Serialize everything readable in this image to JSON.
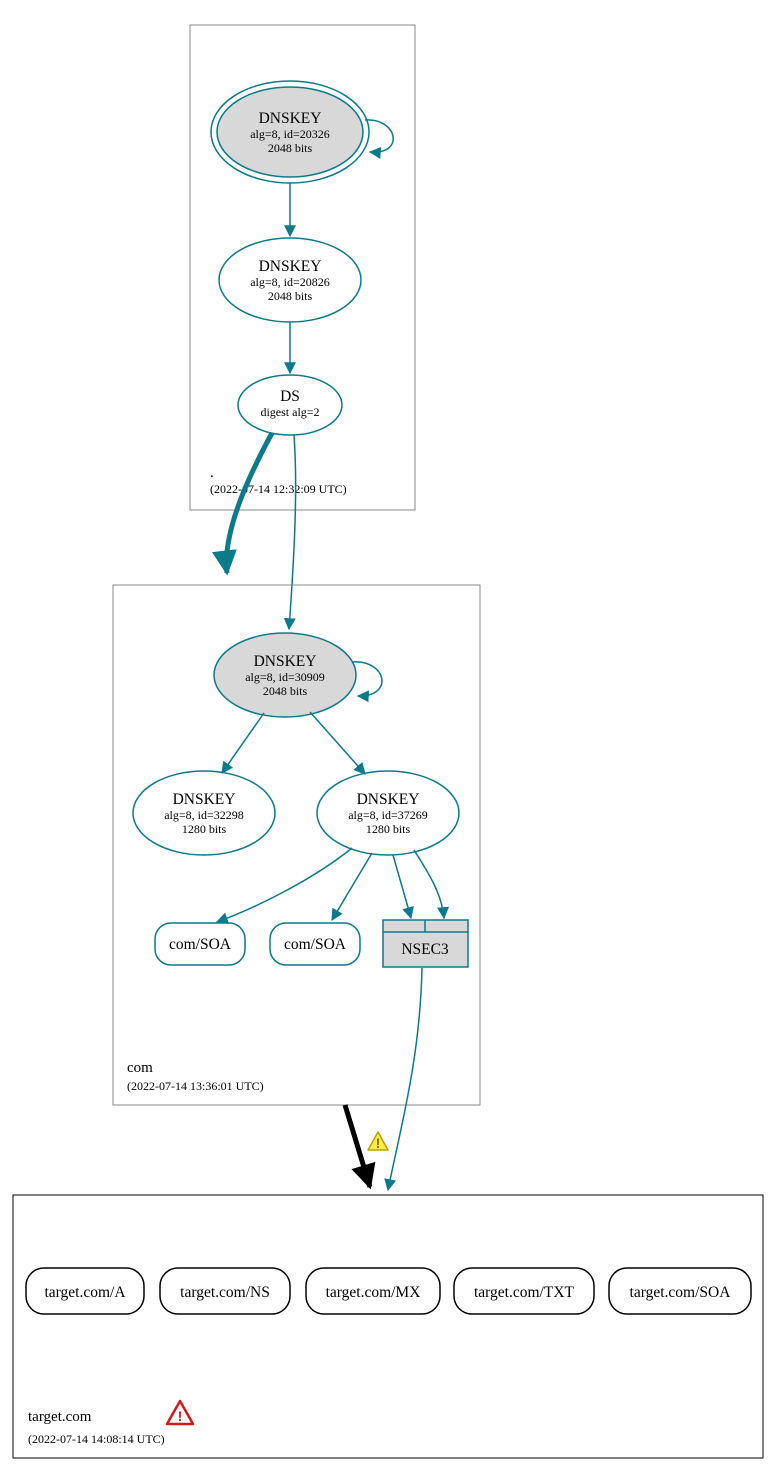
{
  "zones": {
    "root": {
      "label": ".",
      "timestamp": "(2022-07-14 12:32:09 UTC)",
      "ksk": {
        "title": "DNSKEY",
        "line1": "alg=8, id=20326",
        "line2": "2048 bits"
      },
      "zsk": {
        "title": "DNSKEY",
        "line1": "alg=8, id=20826",
        "line2": "2048 bits"
      },
      "ds": {
        "title": "DS",
        "line1": "digest alg=2"
      }
    },
    "com": {
      "label": "com",
      "timestamp": "(2022-07-14 13:36:01 UTC)",
      "ksk": {
        "title": "DNSKEY",
        "line1": "alg=8, id=30909",
        "line2": "2048 bits"
      },
      "zsk1": {
        "title": "DNSKEY",
        "line1": "alg=8, id=32298",
        "line2": "1280 bits"
      },
      "zsk2": {
        "title": "DNSKEY",
        "line1": "alg=8, id=37269",
        "line2": "1280 bits"
      },
      "rr1": "com/SOA",
      "rr2": "com/SOA",
      "nsec3": "NSEC3"
    },
    "target": {
      "label": "target.com",
      "timestamp": "(2022-07-14 14:08:14 UTC)",
      "rr": [
        "target.com/A",
        "target.com/NS",
        "target.com/MX",
        "target.com/TXT",
        "target.com/SOA"
      ]
    }
  },
  "icons": {
    "warn": "!",
    "error": "!"
  }
}
